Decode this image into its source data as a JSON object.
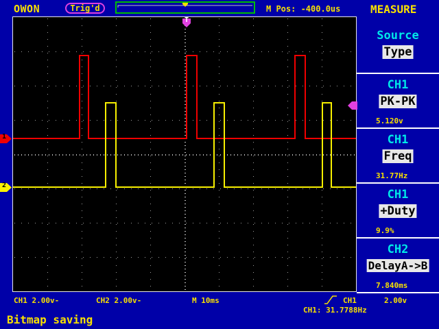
{
  "header": {
    "brand": "OWON",
    "trigger_state": "Trig'd",
    "m_pos": "M Pos: -400.0us",
    "menu_title": "MEASURE"
  },
  "screen_markers": {
    "trigger_pos": "T",
    "ch1_marker": "1",
    "ch2_marker": "2"
  },
  "menu": {
    "items": [
      {
        "title": "Source",
        "value": "Type",
        "readout": ""
      },
      {
        "title": "CH1",
        "value": "PK-PK",
        "readout": "5.120v"
      },
      {
        "title": "CH1",
        "value": "Freq",
        "readout": "31.77Hz"
      },
      {
        "title": "CH1",
        "value": "+Duty",
        "readout": "9.9%"
      },
      {
        "title": "CH2",
        "value": "DelayA->B",
        "readout": "7.840ms"
      }
    ]
  },
  "bottom": {
    "ch1_scale": "CH1 2.00v-",
    "ch2_scale": "CH2 2.00v-",
    "timebase": "M  10ms",
    "trig_source": "CH1",
    "trig_level": "2.00v",
    "ch1_freq": "CH1: 31.7788Hz",
    "status_message": "Bitmap saving"
  },
  "colors": {
    "background": "#0000a8",
    "ch1": "#f00000",
    "ch2": "#f8f000",
    "trigger": "#e040e0",
    "menu_header": "#00e8e8",
    "text": "#f8e000"
  }
}
